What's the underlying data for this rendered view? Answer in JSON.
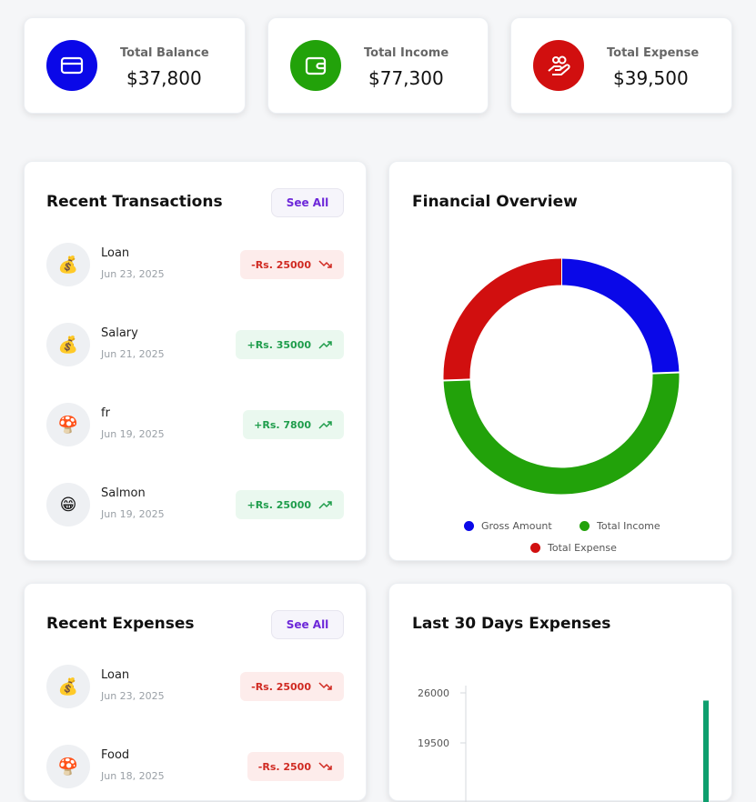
{
  "stats": [
    {
      "label": "Total Balance",
      "value": "$37,800",
      "color": "#0a08e8",
      "icon": "card-icon"
    },
    {
      "label": "Total Income",
      "value": "$77,300",
      "color": "#22a20a",
      "icon": "wallet-icon"
    },
    {
      "label": "Total Expense",
      "value": "$39,500",
      "color": "#d10f0f",
      "icon": "hand-coins-icon"
    }
  ],
  "recent_transactions": {
    "title": "Recent Transactions",
    "see_all": "See All",
    "items": [
      {
        "title": "Loan",
        "date": "Jun 23, 2025",
        "amount": "-Rs. 25000",
        "type": "neg",
        "icon": "💰"
      },
      {
        "title": "Salary",
        "date": "Jun 21, 2025",
        "amount": "+Rs. 35000",
        "type": "pos",
        "icon": "💰"
      },
      {
        "title": "fr",
        "date": "Jun 19, 2025",
        "amount": "+Rs. 7800",
        "type": "pos",
        "icon": "🍄"
      },
      {
        "title": "Salmon",
        "date": "Jun 19, 2025",
        "amount": "+Rs. 25000",
        "type": "pos",
        "icon": "😁"
      }
    ]
  },
  "financial_overview": {
    "title": "Financial Overview",
    "legend": [
      "Gross Amount",
      "Total Income",
      "Total Expense"
    ]
  },
  "recent_expenses": {
    "title": "Recent Expenses",
    "see_all": "See All",
    "items": [
      {
        "title": "Loan",
        "date": "Jun 23, 2025",
        "amount": "-Rs. 25000",
        "type": "neg",
        "icon": "💰"
      },
      {
        "title": "Food",
        "date": "Jun 18, 2025",
        "amount": "-Rs. 2500",
        "type": "neg",
        "icon": "🍄"
      }
    ]
  },
  "last30": {
    "title": "Last 30 Days Expenses",
    "ticks": [
      "26000",
      "19500"
    ]
  },
  "chart_data": [
    {
      "type": "pie",
      "title": "Financial Overview",
      "categories": [
        "Gross Amount",
        "Total Income",
        "Total Expense"
      ],
      "values": [
        37800,
        77300,
        39500
      ],
      "colors": [
        "#0a08e8",
        "#22a20a",
        "#d10f0f"
      ]
    },
    {
      "type": "bar",
      "title": "Last 30 Days Expenses",
      "ylim": [
        0,
        26000
      ],
      "yticks": [
        26000,
        19500
      ],
      "values": [
        25000
      ],
      "colors": [
        "#0e9f6e"
      ]
    }
  ]
}
